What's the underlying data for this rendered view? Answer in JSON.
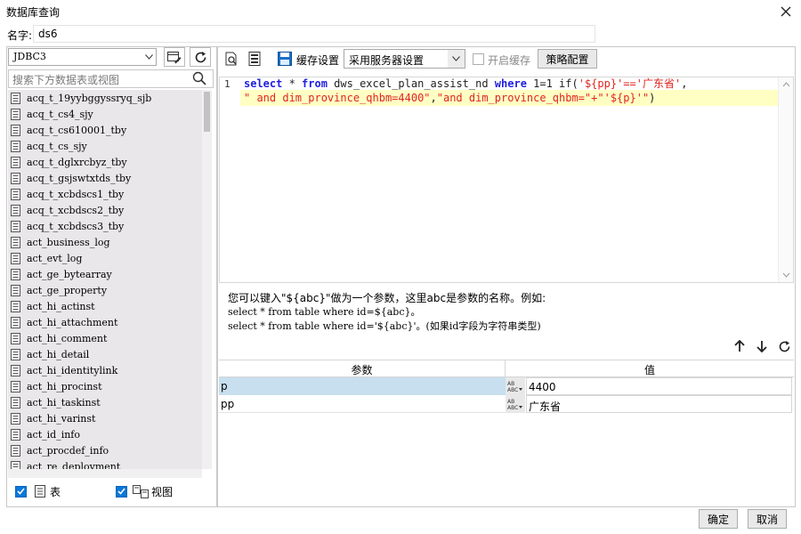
{
  "window": {
    "title": "数据库查询"
  },
  "name_field": {
    "label": "名字:",
    "value": "ds6"
  },
  "left": {
    "connection": "JDBC3",
    "search_placeholder": "搜索下方数据表或视图",
    "tables": [
      "acq_t_19yybggyssryq_sjb",
      "acq_t_cs4_sjy",
      "acq_t_cs610001_tby",
      "acq_t_cs_sjy",
      "acq_t_dglxrcbyz_tby",
      "acq_t_gsjswtxtds_tby",
      "acq_t_xcbdscs1_tby",
      "acq_t_xcbdscs2_tby",
      "acq_t_xcbdscs3_tby",
      "act_business_log",
      "act_evt_log",
      "act_ge_bytearray",
      "act_ge_property",
      "act_hi_actinst",
      "act_hi_attachment",
      "act_hi_comment",
      "act_hi_detail",
      "act_hi_identitylink",
      "act_hi_procinst",
      "act_hi_taskinst",
      "act_hi_varinst",
      "act_id_info",
      "act_procdef_info",
      "act_re_deployment"
    ],
    "table_checkbox_label": "表",
    "view_checkbox_label": "视图"
  },
  "toolbar": {
    "cache_settings_label": "缓存设置",
    "cache_mode": "采用服务器设置",
    "enable_cache_label": "开启缓存",
    "strategy_button": "策略配置"
  },
  "editor": {
    "line_number": "1",
    "line1": {
      "kw_select": "select",
      "star": " * ",
      "kw_from": "from",
      "table": " dws_excel_plan_assist_nd ",
      "kw_where": "where",
      "cond": " 1=1 if(",
      "str1": "'${pp}'=='广东省'",
      "comma": ","
    },
    "line2": {
      "str2": "\" and dim_province_qhbm=4400\"",
      "mid": ",",
      "str3": "\"and dim_province_qhbm=\"+\"'${p}'\"",
      "end": ")"
    }
  },
  "hint": {
    "line1": "您可以键入\"${abc}\"做为一个参数，这里abc是参数的名称。例如:",
    "line2": "select * from table where id=${abc}。",
    "line3": "select * from table where id='${abc}'。(如果id字段为字符串类型)"
  },
  "params": {
    "header_name": "参数",
    "header_value": "值",
    "rows": [
      {
        "name": "p",
        "value": "4400"
      },
      {
        "name": "pp",
        "value": "广东省"
      }
    ]
  },
  "buttons": {
    "ok": "确定",
    "cancel": "取消"
  },
  "colors": {
    "checkbox_blue": "#0a78d7",
    "keyword": "#1f1fdf",
    "string": "#e0251f",
    "row_selected": "#c7dfee"
  }
}
